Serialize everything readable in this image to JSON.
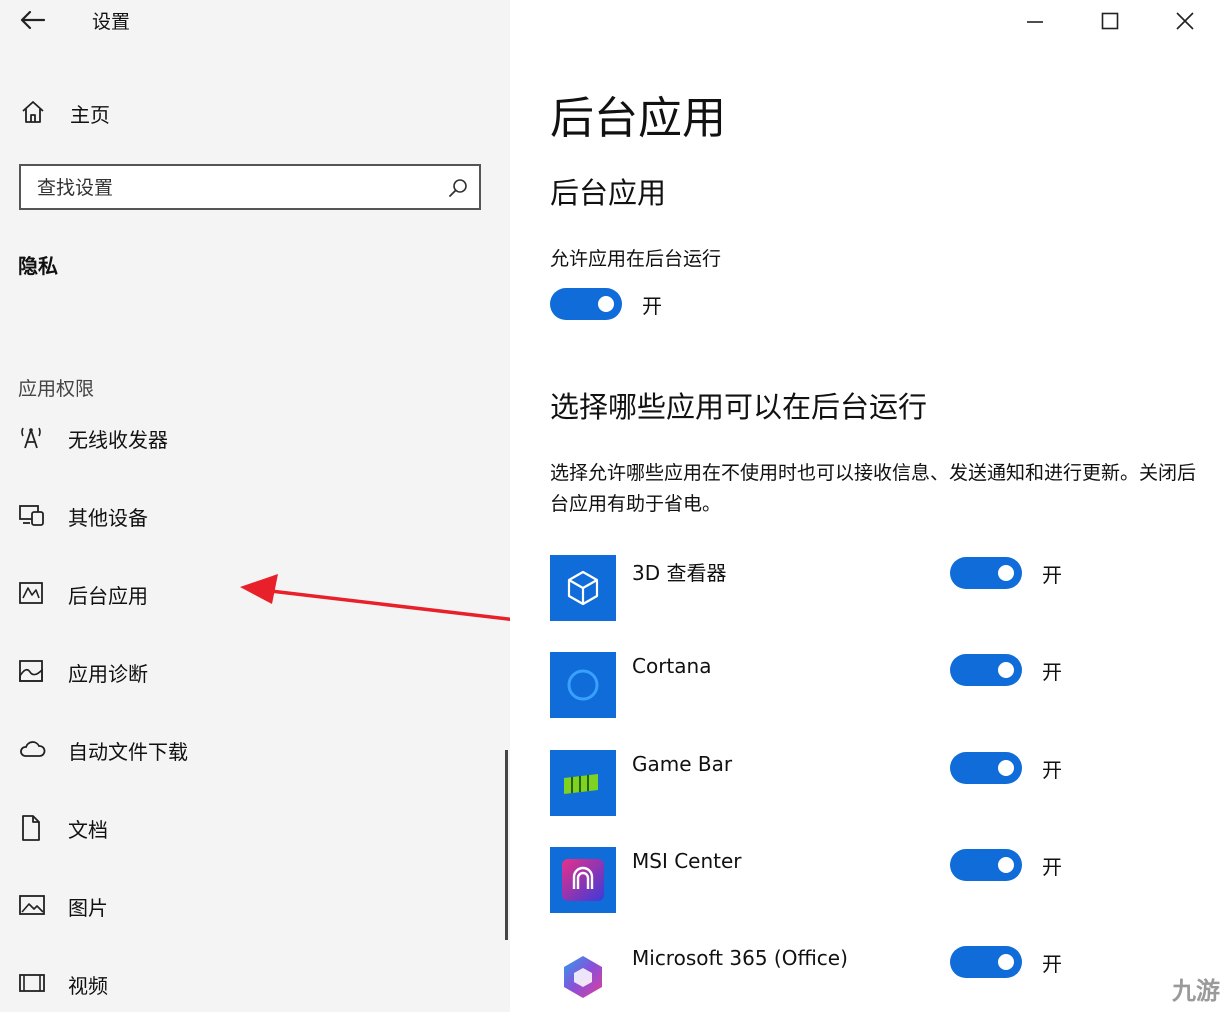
{
  "window": {
    "title": "设置",
    "back_label": "←"
  },
  "sidebar": {
    "home_label": "主页",
    "search_placeholder": "查找设置",
    "section_heading": "隐私",
    "category_label": "应用权限",
    "items": [
      {
        "label": "无线收发器",
        "icon": "antenna-icon"
      },
      {
        "label": "其他设备",
        "icon": "devices-icon"
      },
      {
        "label": "后台应用",
        "icon": "background-apps-icon",
        "highlighted": true
      },
      {
        "label": "应用诊断",
        "icon": "diagnostics-icon"
      },
      {
        "label": "自动文件下载",
        "icon": "cloud-icon"
      },
      {
        "label": "文档",
        "icon": "document-icon"
      },
      {
        "label": "图片",
        "icon": "picture-icon"
      },
      {
        "label": "视频",
        "icon": "video-icon"
      }
    ]
  },
  "main": {
    "page_title": "后台应用",
    "section_title": "后台应用",
    "allow_label": "允许应用在后台运行",
    "allow_state": "开",
    "choose_title": "选择哪些应用可以在后台运行",
    "choose_desc": "选择允许哪些应用在不使用时也可以接收信息、发送通知和进行更新。关闭后台应用有助于省电。",
    "apps": [
      {
        "name": "3D 查看器",
        "state": "开",
        "icon": "cube-icon"
      },
      {
        "name": "Cortana",
        "state": "开",
        "icon": "cortana-ring-icon"
      },
      {
        "name": "Game Bar",
        "state": "开",
        "icon": "gamebar-icon"
      },
      {
        "name": "MSI Center",
        "state": "开",
        "icon": "msi-center-icon"
      },
      {
        "name": "Microsoft 365 (Office)",
        "state": "开",
        "icon": "office-icon"
      }
    ]
  },
  "watermark": "九游",
  "colors": {
    "accent": "#0f6cd8",
    "sidebar_bg": "#f4f4f4",
    "arrow": "#e8202a"
  }
}
